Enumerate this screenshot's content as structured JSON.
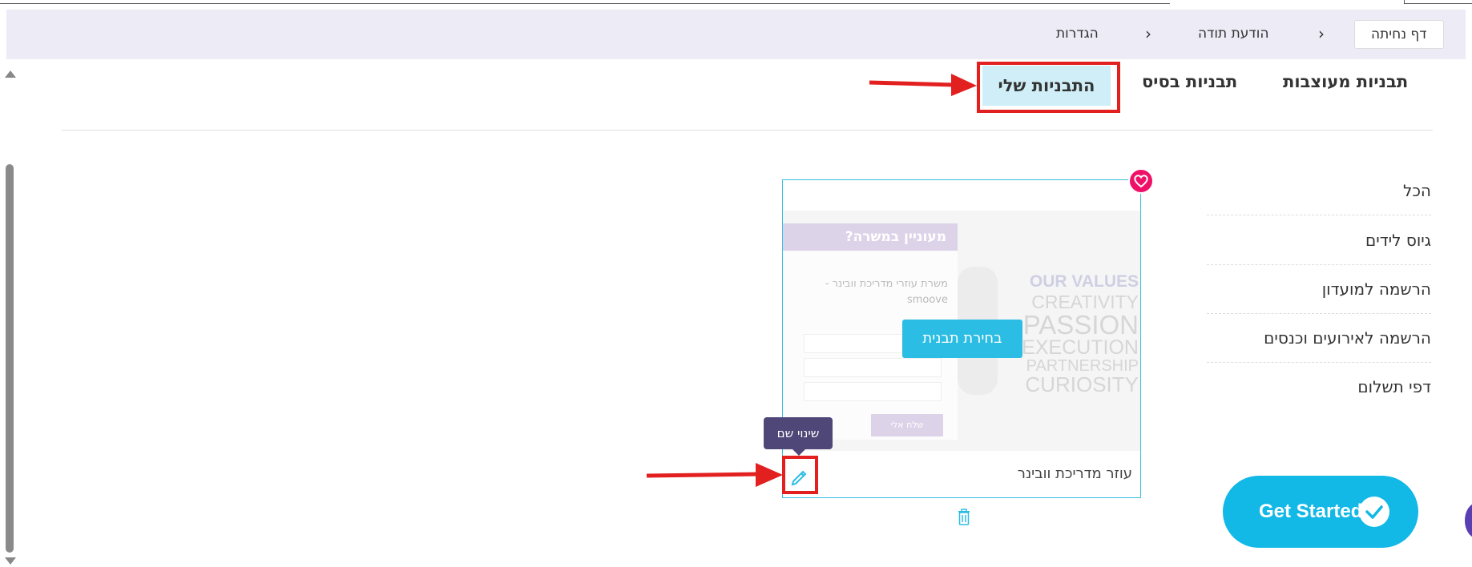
{
  "wizard": {
    "steps": [
      {
        "label": "דף נחיתה",
        "active": true
      },
      {
        "label": "הודעת תודה",
        "active": false
      },
      {
        "label": "הגדרות",
        "active": false
      }
    ],
    "separator": "›"
  },
  "tabs": [
    {
      "label": "תבניות מעוצבות"
    },
    {
      "label": "תבניות בסיס"
    },
    {
      "label": "התבניות שלי",
      "active": true
    }
  ],
  "categories": [
    "הכל",
    "גיוס לידים",
    "הרשמה למועדון",
    "הרשמה לאירועים וכנסים",
    "דפי תשלום"
  ],
  "template_card": {
    "name": "עוזר מדריכת וובינר",
    "choose_label": "בחירת תבנית",
    "tooltip": "שינוי שם",
    "preview": {
      "heading": "מעוניין במשרה?",
      "subtext": "משרת עוזרי מדריכת וובינר - smoove",
      "button": "שלח אלי",
      "values_title": "OUR VALUES",
      "values": [
        "CREATIVITY",
        "PASSION",
        "EXECUTION",
        "PARTNERSHIP",
        "CURIOSITY"
      ]
    }
  },
  "floating": {
    "get_started": "Get Started"
  },
  "icons": {
    "favorite": "heart-icon",
    "rename": "pencil-icon",
    "delete": "trash-icon",
    "check": "check-icon"
  },
  "colors": {
    "accent": "#2bbde3",
    "highlight_tab": "#cfeef7",
    "annotation": "#e32020",
    "heart": "#ee1167",
    "tooltip_bg": "#4e4777",
    "wizard_bg": "#ecebf6"
  }
}
